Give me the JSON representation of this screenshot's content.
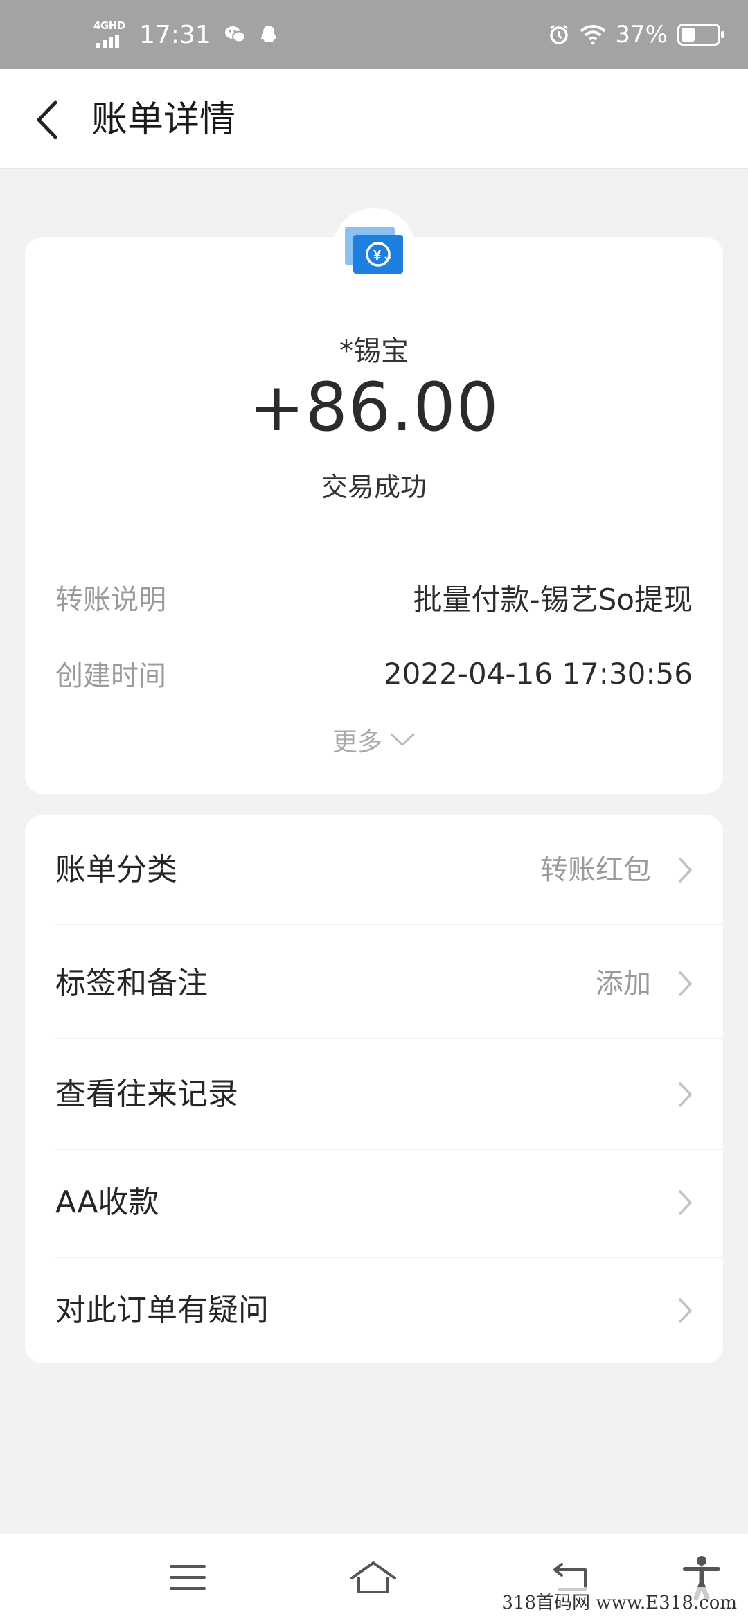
{
  "status_bar": {
    "network": "4GHD",
    "time": "17:31",
    "battery_percent": "37%",
    "battery_level": 0.37
  },
  "header": {
    "title": "账单详情"
  },
  "transaction": {
    "payer": "*锡宝",
    "amount": "+86.00",
    "status": "交易成功",
    "details": [
      {
        "label": "转账说明",
        "value": "批量付款-锡艺So提现"
      },
      {
        "label": "创建时间",
        "value": "2022-04-16 17:30:56"
      }
    ],
    "more_label": "更多"
  },
  "menu": {
    "items": [
      {
        "label": "账单分类",
        "value": "转账红包"
      },
      {
        "label": "标签和备注",
        "value": "添加"
      },
      {
        "label": "查看往来记录",
        "value": ""
      },
      {
        "label": "AA收款",
        "value": ""
      },
      {
        "label": "对此订单有疑问",
        "value": ""
      }
    ]
  },
  "watermark": "318首码网 www.E318.com",
  "colors": {
    "status_bar_bg": "#a3a3a5",
    "page_bg": "#f2f2f4",
    "icon_blue": "#1e7fe0"
  }
}
